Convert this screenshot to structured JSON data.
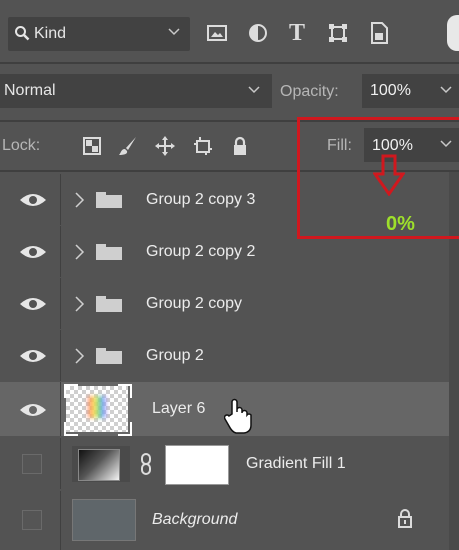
{
  "filter": {
    "kind_label": "Kind",
    "icons": [
      "image-filter-icon",
      "adjustment-filter-icon",
      "type-filter-icon",
      "shape-filter-icon",
      "smart-object-filter-icon"
    ],
    "type_glyph": "T"
  },
  "blend": {
    "mode": "Normal",
    "opacity_label": "Opacity:",
    "opacity_value": "100%"
  },
  "lock": {
    "label": "Lock:",
    "icons": [
      "lock-transparent-pixels-icon",
      "lock-image-pixels-icon",
      "lock-position-icon",
      "lock-artboard-icon",
      "lock-all-icon"
    ],
    "fill_label": "Fill:",
    "fill_value": "100%"
  },
  "annotation": {
    "target_text": "0%",
    "color": "#d0181e",
    "text_color": "#9ee02b"
  },
  "layers": [
    {
      "name": "Group 2 copy 3",
      "type": "group",
      "visible": true
    },
    {
      "name": "Group 2 copy 2",
      "type": "group",
      "visible": true
    },
    {
      "name": "Group 2 copy",
      "type": "group",
      "visible": true
    },
    {
      "name": "Group 2",
      "type": "group",
      "visible": true
    },
    {
      "name": "Layer 6",
      "type": "pixel",
      "visible": true,
      "selected": true
    },
    {
      "name": "Gradient Fill 1",
      "type": "fill",
      "visible": false
    },
    {
      "name": "Background",
      "type": "background",
      "visible": false,
      "locked": true
    }
  ],
  "colors": {
    "panel_bg": "#535353",
    "field_bg": "#424242",
    "selected_row": "#666666",
    "background_swatch": "#5f666a"
  }
}
